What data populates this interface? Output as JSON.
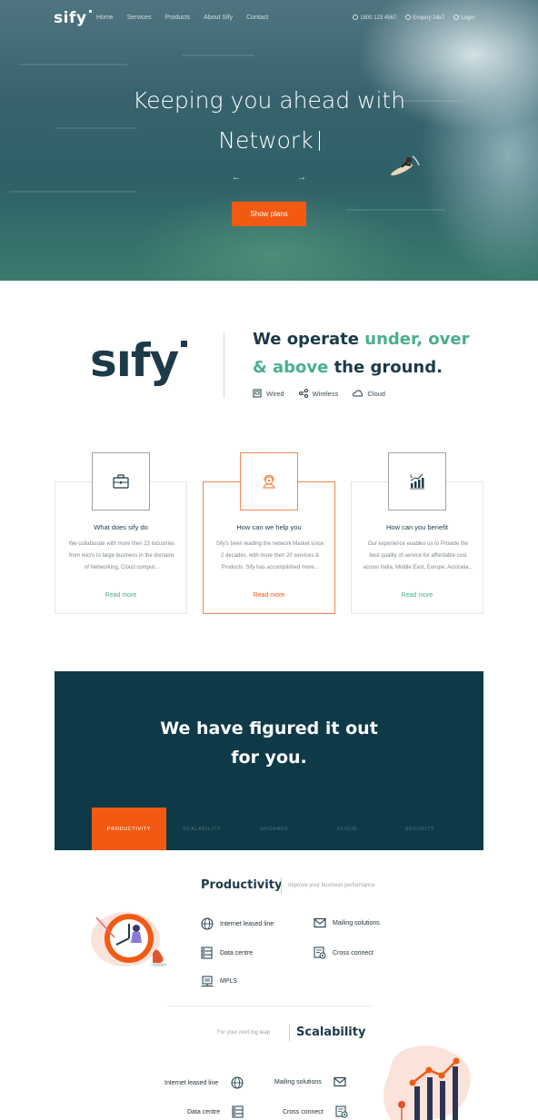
{
  "nav": {
    "logo": "sify",
    "links": [
      "Home",
      "Services",
      "Products",
      "About Sify",
      "Contact"
    ],
    "phone": "1800 123 4567",
    "enquiry": "Enquiry 24x7",
    "login": "Login"
  },
  "hero": {
    "title_line1": "Keeping you ahead with",
    "title_line2": "Network",
    "prev_arrow": "←",
    "next_arrow": "→",
    "cta": "Show plans"
  },
  "about": {
    "brand": "sıfy",
    "headline_part1": "We operate ",
    "headline_hl1": "under, over",
    "headline_hl2": "& above",
    "headline_part2": " the ground.",
    "tags": [
      "Wired",
      "Wireless",
      "Cloud"
    ]
  },
  "cards": [
    {
      "icon": "briefcase-icon",
      "title": "What does sify do",
      "text": "We collaborate with more then 23 industries from micro to large business in the domains of Networking, Cloud comput...",
      "link": "Read more"
    },
    {
      "icon": "support-agent-icon",
      "title": "How can we help you",
      "text": "Sify's been leading the network Market since 2 decades, with more then 20 services & Products. Sify has accomplished more...",
      "link": "Read more"
    },
    {
      "icon": "growth-chart-icon",
      "title": "How can you benefit",
      "text": "Our experience enables us to Provide the best quality of service for affordable cost across India, Middle East, Europe, Australia...",
      "link": "Read more"
    }
  ],
  "panel": {
    "title_line1": "We have figured it out",
    "title_line2": "for you.",
    "tabs": [
      "PRODUCTIVITY",
      "SCALABILITY",
      "UPGRADE",
      "CLOUD",
      "SECURITY"
    ]
  },
  "productivity": {
    "title": "Productivity",
    "subtitle": "Improve your business performance",
    "items": [
      "Internet leased line",
      "Mailing solutions",
      "Data centre",
      "Cross connect",
      "MPLS"
    ]
  },
  "scalability": {
    "title": "Scalability",
    "subtitle": "For your next big leap",
    "items": [
      "Internet leased line",
      "Mailing solutions",
      "Data centre",
      "Cross connect"
    ]
  },
  "colors": {
    "accent": "#f25a14",
    "brand": "#1c3a48",
    "green": "#49b08a",
    "panel": "#0e3a48"
  }
}
